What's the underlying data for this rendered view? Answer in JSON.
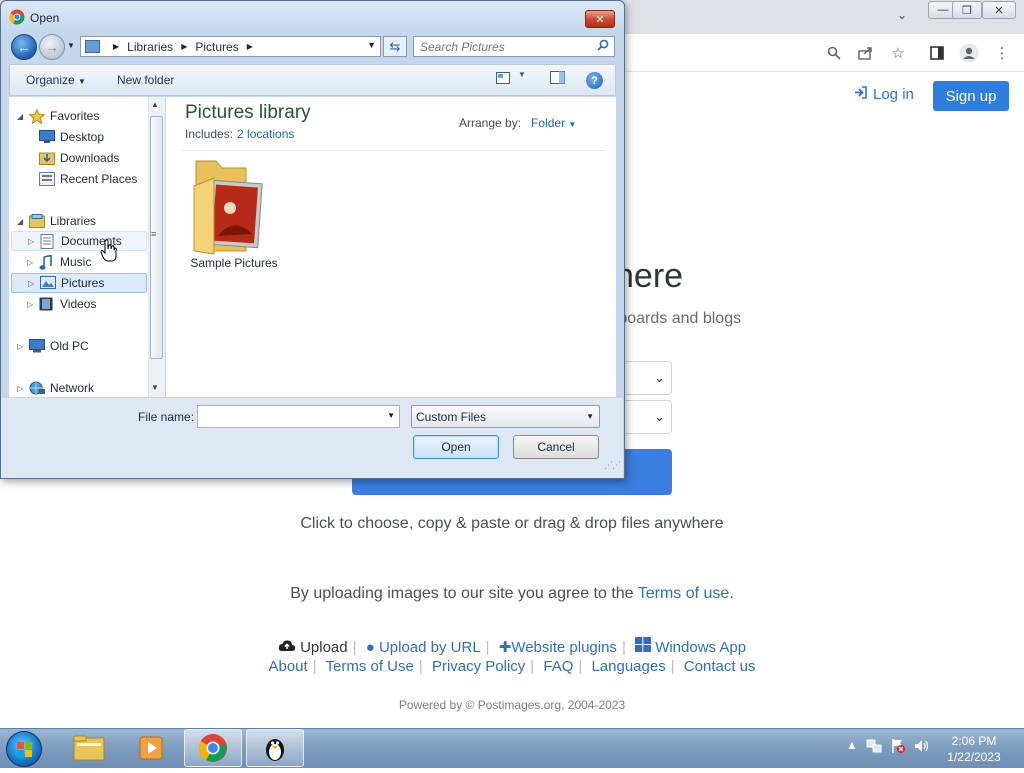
{
  "browser": {
    "login_label": "Log in",
    "signup_label": "Sign up",
    "hero_title_fragment": "here",
    "hero_subtitle_fragment": "e boards and blogs",
    "hint_text": "Click to choose, copy & paste or drag & drop files anywhere",
    "agree_text": "By uploading images to our site you agree to the",
    "terms_link": "Terms of use",
    "agree_end": ".",
    "footer_row1": {
      "upload": "Upload",
      "upload_by_url": "Upload by URL",
      "website_plugins": "Website plugins",
      "windows_app": "Windows App"
    },
    "footer_row2": [
      "About",
      "Terms of Use",
      "Privacy Policy",
      "FAQ",
      "Languages",
      "Contact us"
    ],
    "powered_by": "Powered by © Postimages.org, 2004-2023"
  },
  "dialog": {
    "title": "Open",
    "breadcrumb": [
      "Libraries",
      "Pictures"
    ],
    "search_placeholder": "Search Pictures",
    "commands": {
      "organize": "Organize",
      "new_folder": "New folder"
    },
    "nav": {
      "favorites": "Favorites",
      "desktop": "Desktop",
      "downloads": "Downloads",
      "recent_places": "Recent Places",
      "libraries": "Libraries",
      "documents": "Documents",
      "music": "Music",
      "pictures": "Pictures",
      "videos": "Videos",
      "old_pc": "Old PC",
      "network": "Network"
    },
    "library_title": "Pictures library",
    "includes_label": "Includes:",
    "includes_link": "2 locations",
    "arrange_label": "Arrange by:",
    "arrange_value": "Folder",
    "folder_item": "Sample Pictures",
    "file_name_label": "File name:",
    "file_name_value": "",
    "filter_value": "Custom Files",
    "open_label": "Open",
    "cancel_label": "Cancel"
  },
  "taskbar": {
    "time": "2:06 PM",
    "date": "1/22/2023"
  },
  "colors": {
    "accent": "#2f7ddf",
    "link": "#2f6ec2",
    "library_title": "#1e5a2e"
  }
}
